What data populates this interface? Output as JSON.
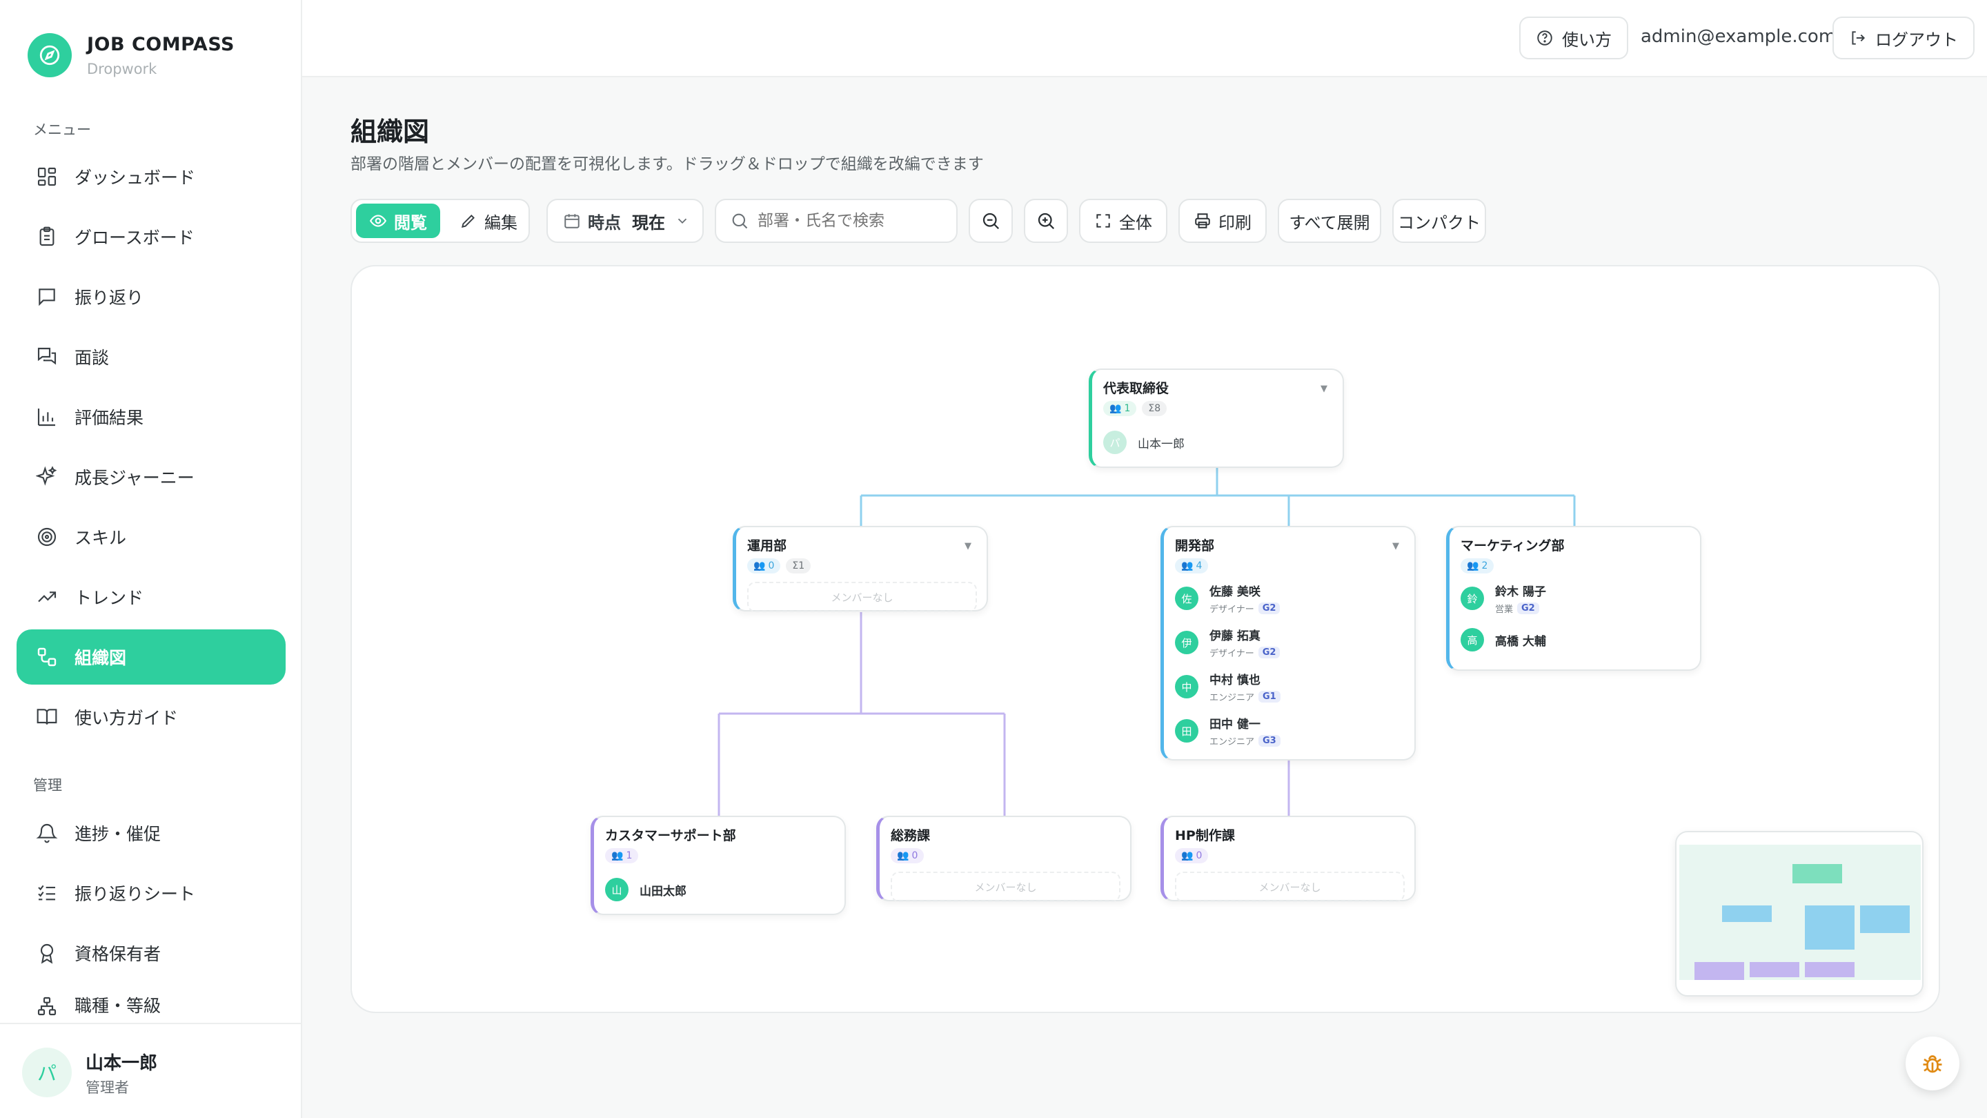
{
  "brand": {
    "title": "JOB COMPASS",
    "subtitle": "Dropwork"
  },
  "sidebar": {
    "menu_label": "メニュー",
    "admin_label": "管理",
    "menu_items": [
      {
        "label": "ダッシュボード",
        "icon": "dashboard-icon"
      },
      {
        "label": "グロースボード",
        "icon": "clipboard-icon"
      },
      {
        "label": "振り返り",
        "icon": "chat-icon"
      },
      {
        "label": "面談",
        "icon": "chat-bubbles-icon"
      },
      {
        "label": "評価結果",
        "icon": "bar-chart-icon"
      },
      {
        "label": "成長ジャーニー",
        "icon": "sparkles-icon"
      },
      {
        "label": "スキル",
        "icon": "target-icon"
      },
      {
        "label": "トレンド",
        "icon": "trend-icon"
      },
      {
        "label": "組織図",
        "icon": "org-chart-icon",
        "active": true
      },
      {
        "label": "使い方ガイド",
        "icon": "book-icon"
      }
    ],
    "admin_items": [
      {
        "label": "進捗・催促",
        "icon": "bell-icon"
      },
      {
        "label": "振り返りシート",
        "icon": "checklist-icon"
      },
      {
        "label": "資格保有者",
        "icon": "award-icon"
      },
      {
        "label": "職種・等級",
        "icon": "hierarchy-icon"
      }
    ]
  },
  "user": {
    "initial": "パ",
    "name": "山本一郎",
    "role": "管理者"
  },
  "header": {
    "help_label": "使い方",
    "email": "admin@example.com",
    "logout_label": "ログアウト"
  },
  "page": {
    "title": "組織図",
    "description": "部署の階層とメンバーの配置を可視化します。ドラッグ＆ドロップで組織を改編できます"
  },
  "toolbar": {
    "view_label": "閲覧",
    "edit_label": "編集",
    "time_label": "時点",
    "time_value": "現在",
    "search_placeholder": "部署・氏名で検索",
    "fit_label": "全体",
    "print_label": "印刷",
    "expand_label": "すべて展開",
    "compact_label": "コンパクト"
  },
  "colors": {
    "accent": "#2ecf9e",
    "blue": "#52b6ea",
    "purple": "#a690e8"
  },
  "org": {
    "root": {
      "name": "代表取締役",
      "count": "1",
      "total": "Σ8",
      "members": [
        {
          "initial": "パ",
          "name": "山本一郎"
        }
      ]
    },
    "ops": {
      "name": "運用部",
      "count": "0",
      "total": "Σ1",
      "empty": "メンバーなし"
    },
    "dev": {
      "name": "開発部",
      "count": "4",
      "members": [
        {
          "initial": "佐",
          "name": "佐藤 美咲",
          "role": "デザイナー",
          "grade": "G2"
        },
        {
          "initial": "伊",
          "name": "伊藤 拓真",
          "role": "デザイナー",
          "grade": "G2"
        },
        {
          "initial": "中",
          "name": "中村 慎也",
          "role": "エンジニア",
          "grade": "G1"
        },
        {
          "initial": "田",
          "name": "田中 健一",
          "role": "エンジニア",
          "grade": "G3"
        }
      ]
    },
    "mkt": {
      "name": "マーケティング部",
      "count": "2",
      "members": [
        {
          "initial": "鈴",
          "name": "鈴木 陽子",
          "role": "営業",
          "grade": "G2"
        },
        {
          "initial": "高",
          "name": "高橋 大輔"
        }
      ]
    },
    "cs": {
      "name": "カスタマーサポート部",
      "count": "1",
      "members": [
        {
          "initial": "山",
          "name": "山田太郎"
        }
      ]
    },
    "ga": {
      "name": "総務課",
      "count": "0",
      "empty": "メンバーなし"
    },
    "hp": {
      "name": "HP制作課",
      "count": "0",
      "empty": "メンバーなし"
    }
  }
}
